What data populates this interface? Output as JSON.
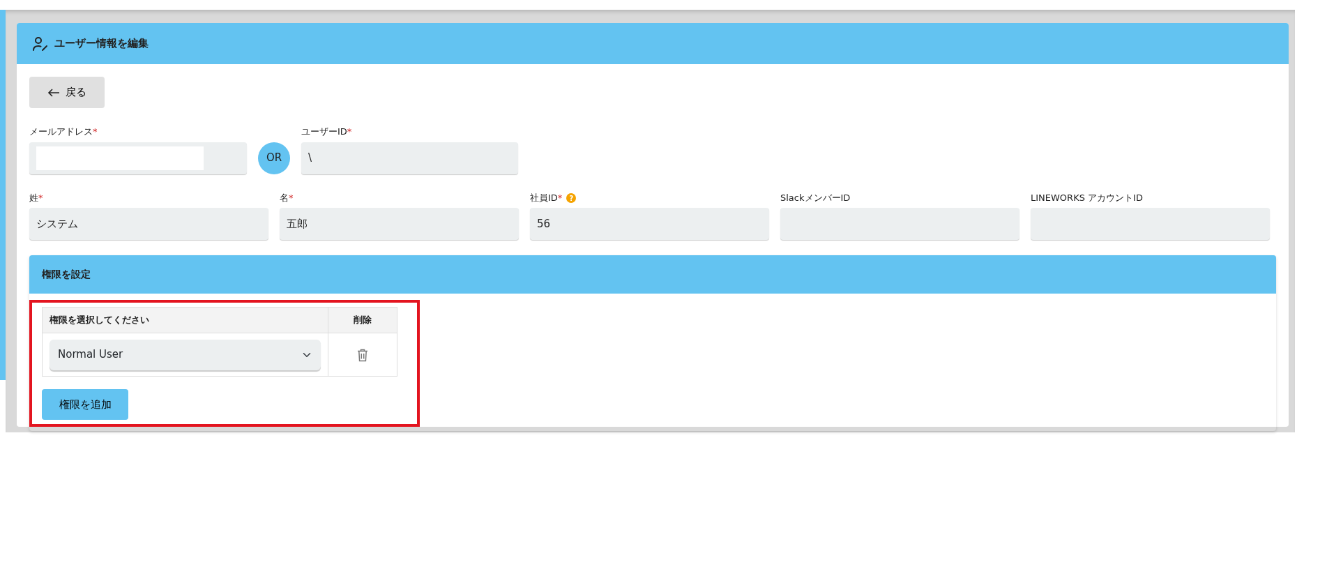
{
  "card": {
    "title": "ユーザー情報を編集"
  },
  "back_button": {
    "label": "戻る"
  },
  "login_fields": [
    {
      "label": "メールアドレス",
      "required_mark": "*",
      "masked": true
    },
    {
      "label": "ユーザーID",
      "required_mark": "*",
      "value": "\\"
    }
  ],
  "or_badge": "OR",
  "profile_fields": [
    {
      "label": "姓",
      "required_mark": "*",
      "value": "システム"
    },
    {
      "label": "名",
      "required_mark": "*",
      "value": "五郎"
    },
    {
      "label": "社員ID",
      "required_mark": "*",
      "help": "?",
      "value": "56"
    },
    {
      "label": "SlackメンバーID"
    },
    {
      "label": "LINEWORKS アカウントID"
    }
  ],
  "permissions": {
    "title": "権限を設定",
    "highlighted": true,
    "columns": [
      "権限を選択してください",
      "削除"
    ],
    "rows": [
      {
        "role": "Normal User"
      }
    ],
    "add_button": "権限を追加"
  }
}
